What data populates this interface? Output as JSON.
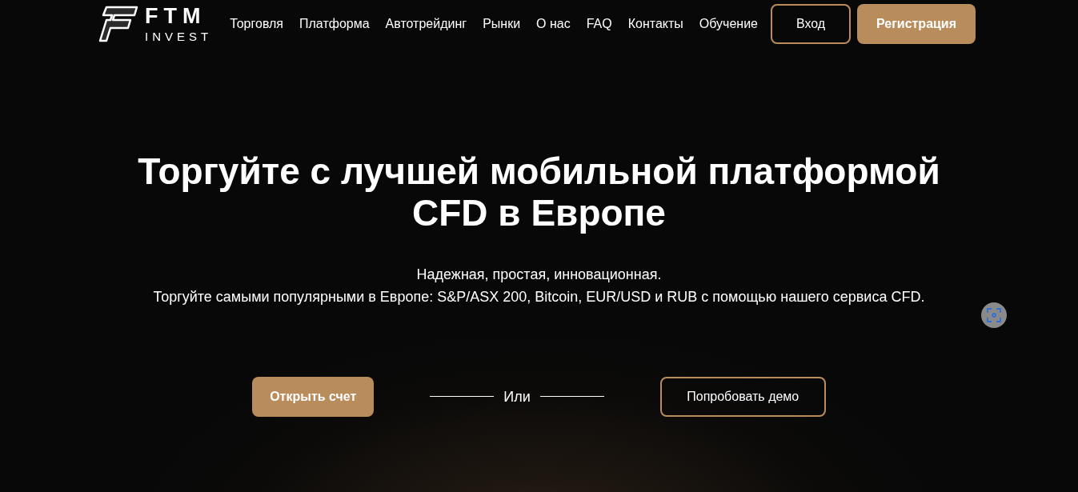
{
  "logo": {
    "title": "FTM",
    "subtitle": "INVEST"
  },
  "nav": {
    "links": [
      "Торговля",
      "Платформа",
      "Автотрейдинг",
      "Рынки",
      "О нас",
      "FAQ",
      "Контакты",
      "Обучение"
    ],
    "login": "Вход",
    "register": "Регистрация"
  },
  "hero": {
    "title": "Торгуйте с лучшей мобильной платформой CFD в Европе",
    "lines": [
      "Надежная, простая, инновационная.",
      "Торгуйте самыми популярными в Европе: S&P/ASX 200, Bitcoin, EUR/USD и RUB с помощью нашего сервиса CFD."
    ],
    "primary_button": "Открыть счет",
    "separator": "Или",
    "secondary_button": "Попробовать демо"
  }
}
